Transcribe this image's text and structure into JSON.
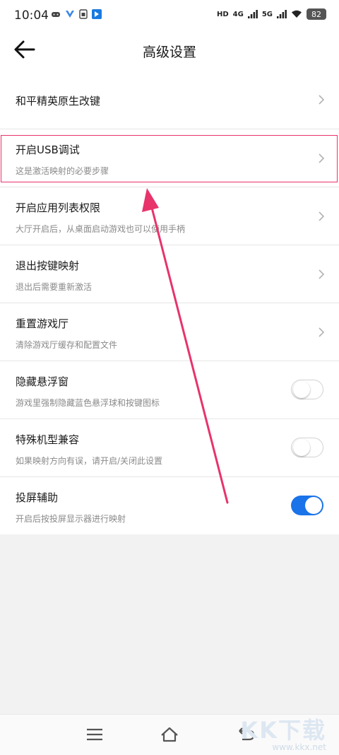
{
  "status_bar": {
    "time": "10:04",
    "hd_label": "HD",
    "net1_label": "4G",
    "net2_label": "5G",
    "battery": "82"
  },
  "header": {
    "title": "高级设置",
    "back_icon": "arrow-left-icon"
  },
  "settings": [
    {
      "title": "和平精英原生改键",
      "control": "chevron"
    },
    {
      "title": "开启USB调试",
      "subtitle": "这是激活映射的必要步骤",
      "control": "chevron"
    },
    {
      "title": "开启应用列表权限",
      "subtitle": "大厅开启后，从桌面启动游戏也可以使用手柄",
      "control": "chevron"
    },
    {
      "title": "退出按键映射",
      "subtitle": "退出后需要重新激活",
      "control": "chevron"
    },
    {
      "title": "重置游戏厅",
      "subtitle": "清除游戏厅缓存和配置文件",
      "control": "chevron"
    },
    {
      "title": "隐藏悬浮窗",
      "subtitle": "游戏里强制隐藏蓝色悬浮球和按键图标",
      "control": "toggle",
      "on": false
    },
    {
      "title": "特殊机型兼容",
      "subtitle": "如果映射方向有误，请开启/关闭此设置",
      "control": "toggle",
      "on": false
    },
    {
      "title": "投屏辅助",
      "subtitle": "开启后按投屏显示器进行映射",
      "control": "toggle",
      "on": true
    }
  ],
  "watermark": {
    "title": "KK下载",
    "url": "www.kkx.net"
  },
  "colors": {
    "accent": "#1a73e8",
    "highlight": "#e8336b",
    "background": "#f2f2f2"
  }
}
